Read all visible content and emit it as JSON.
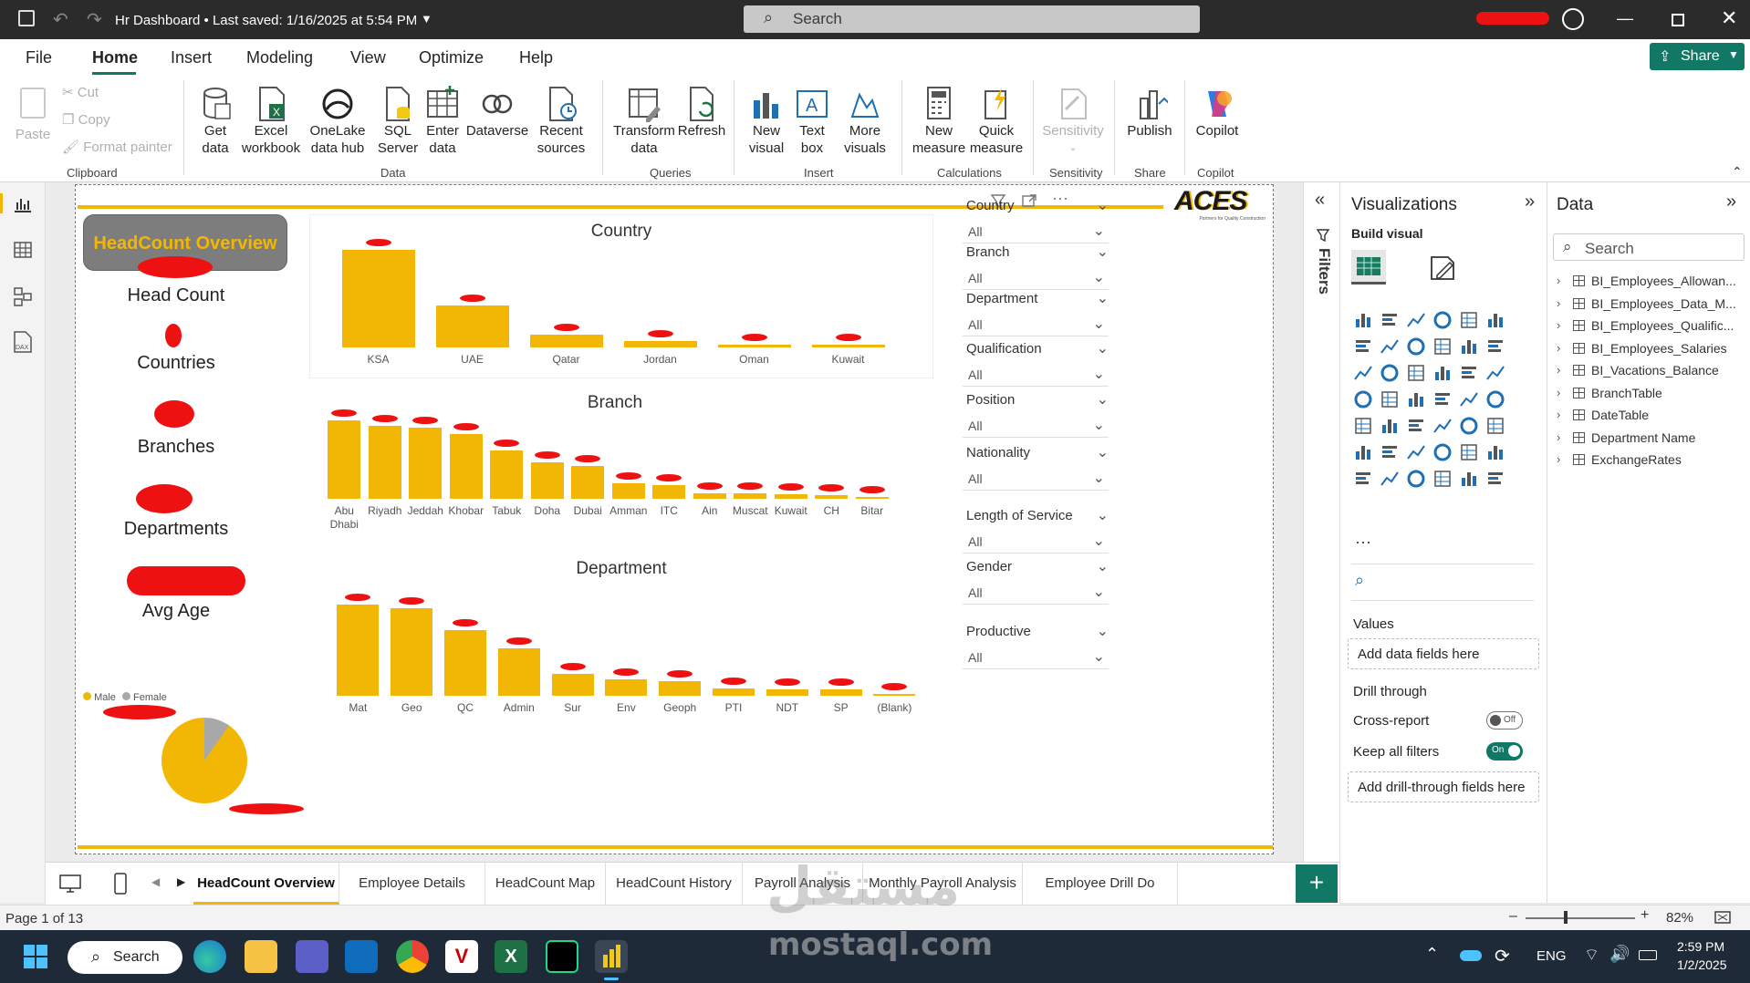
{
  "titlebar": {
    "title": "Hr Dashboard • Last saved: 1/16/2025 at 5:54 PM",
    "search_placeholder": "Search"
  },
  "menu": [
    "File",
    "Home",
    "Insert",
    "Modeling",
    "View",
    "Optimize",
    "Help"
  ],
  "share_label": "Share",
  "ribbon": {
    "paste": "Paste",
    "cut": "Cut",
    "copy": "Copy",
    "format_painter": "Format painter",
    "clipboard": "Clipboard",
    "get_data": [
      "Get",
      "data"
    ],
    "excel": [
      "Excel",
      "workbook"
    ],
    "onelake": [
      "OneLake",
      "data hub"
    ],
    "sql": [
      "SQL",
      "Server"
    ],
    "enter": [
      "Enter",
      "data"
    ],
    "dataverse": "Dataverse",
    "recent": [
      "Recent",
      "sources"
    ],
    "data": "Data",
    "transform": [
      "Transform",
      "data"
    ],
    "refresh": "Refresh",
    "queries": "Queries",
    "new_visual": [
      "New",
      "visual"
    ],
    "text_box": [
      "Text",
      "box"
    ],
    "more_visuals": [
      "More",
      "visuals"
    ],
    "insert": "Insert",
    "new_measure": [
      "New",
      "measure"
    ],
    "quick_measure": [
      "Quick",
      "measure"
    ],
    "calculations": "Calculations",
    "sensitivity_btn": "Sensitivity",
    "sensitivity": "Sensitivity",
    "publish": "Publish",
    "share_grp": "Share",
    "copilot": "Copilot",
    "copilot_grp": "Copilot"
  },
  "report": {
    "header": "HeadCount Overview",
    "logo": "ACES",
    "logo_sub": "Partners for Quality Construction",
    "cards": [
      "Head Count",
      "Countries",
      "Branches",
      "Departments",
      "Avg Age"
    ],
    "legend": [
      "Male",
      "Female"
    ],
    "country": {
      "title": "Country",
      "categories": [
        "KSA",
        "UAE",
        "Qatar",
        "Jordan",
        "Oman",
        "Kuwait"
      ]
    },
    "branch": {
      "title": "Branch",
      "categories": [
        "Abu Dhabi",
        "Riyadh",
        "Jeddah",
        "Khobar",
        "Tabuk",
        "Doha",
        "Dubai",
        "Amman",
        "ITC",
        "Ain",
        "Muscat",
        "Kuwait",
        "CH",
        "Bitar"
      ]
    },
    "department": {
      "title": "Department",
      "categories": [
        "Mat",
        "Geo",
        "QC",
        "Admin",
        "Sur",
        "Env",
        "Geoph",
        "PTI",
        "NDT",
        "SP",
        "(Blank)"
      ]
    }
  },
  "slicers": [
    {
      "label": "Country",
      "value": "All"
    },
    {
      "label": "Branch",
      "value": "All"
    },
    {
      "label": "Department",
      "value": "All"
    },
    {
      "label": "Qualification",
      "value": "All"
    },
    {
      "label": "Position",
      "value": "All"
    },
    {
      "label": "Nationality",
      "value": "All"
    },
    {
      "label": "Length of Service",
      "value": "All"
    },
    {
      "label": "Gender",
      "value": "All"
    },
    {
      "label": "Productive",
      "value": "All"
    }
  ],
  "filters_label": "Filters",
  "visualizations": {
    "title": "Visualizations",
    "build": "Build visual",
    "values": "Values",
    "add_fields": "Add data fields here",
    "drill": "Drill through",
    "cross": "Cross-report",
    "cross_state": "Off",
    "keep": "Keep all filters",
    "keep_state": "On",
    "add_drill": "Add drill-through fields here"
  },
  "data_panel": {
    "title": "Data",
    "search_placeholder": "Search",
    "tables": [
      "BI_Employees_Allowan...",
      "BI_Employees_Data_M...",
      "BI_Employees_Qualific...",
      "BI_Employees_Salaries",
      "BI_Vacations_Balance",
      "BranchTable",
      "DateTable",
      "Department Name",
      "ExchangeRates"
    ]
  },
  "tabs": [
    "HeadCount Overview",
    "Employee Details",
    "HeadCount Map",
    "HeadCount History",
    "Payroll Analysis",
    "Monthly Payroll Analysis",
    "Employee Drill Do"
  ],
  "status": {
    "page": "Page 1 of 13",
    "zoom": "82%"
  },
  "taskbar": {
    "search": "Search",
    "lang": "ENG",
    "time": "2:59 PM",
    "date": "1/2/2025"
  },
  "watermark": {
    "arabic": "مستقل",
    "site": "mostaql.com"
  },
  "colors": {
    "accent": "#f2b705",
    "brand": "#f2c811",
    "share": "#117865"
  }
}
